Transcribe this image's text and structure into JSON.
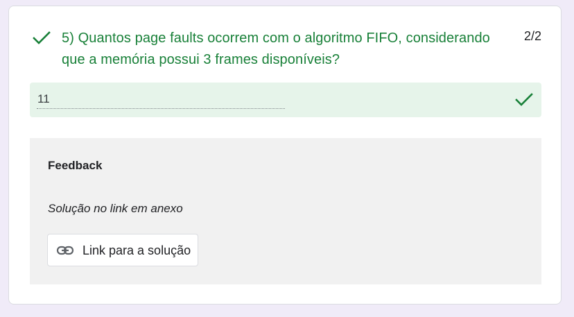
{
  "question": {
    "title": "5) Quantos page faults ocorrem com o algoritmo FIFO, considerando que a memória possui 3 frames disponíveis?",
    "score": "2/2",
    "status_icon": "check-icon",
    "status_color": "#188038"
  },
  "answer": {
    "value": "11",
    "status_icon": "check-icon",
    "background": "#e6f4ea"
  },
  "feedback": {
    "heading": "Feedback",
    "text": "Solução no link em anexo",
    "link": {
      "icon": "link-icon",
      "label": "Link para a solução"
    }
  }
}
